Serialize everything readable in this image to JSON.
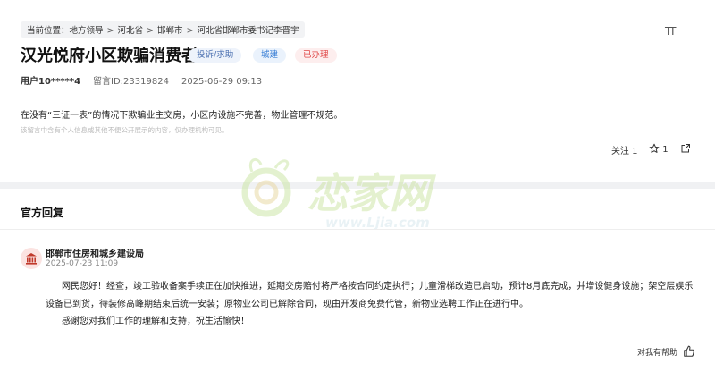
{
  "breadcrumb": {
    "prefix": "当前位置：",
    "items": [
      "地方领导",
      "河北省",
      "邯郸市",
      "河北省邯郸市委书记李晋宇"
    ]
  },
  "font_toggle": "TT",
  "message": {
    "title": "汉光悦府小区欺骗消费者",
    "tags": {
      "type": "投诉/求助",
      "category": "城建",
      "status": "已办理"
    },
    "user": "用户10*****4",
    "message_id": "留言ID:23319824",
    "date": "2025-06-29 09:13",
    "content": "在没有“三证一表”的情况下欺骗业主交房，小区内设施不完善，物业管理不规范。",
    "note": "该留言中含有个人信息或其他不便公开展示的内容，仅办理机构可见。",
    "follow": "关注 1",
    "stars": "1"
  },
  "watermark": {
    "logo": "恋家网",
    "url": "www.Ljia.com"
  },
  "reply_section": {
    "title": "官方回复",
    "org": "邯郸市住房和城乡建设局",
    "time": "2025-07-23 11:09",
    "p1": "网民您好！经查，竣工验收备案手续正在加快推进，延期交房赔付将严格按合同约定执行；儿童滑梯改造已启动，预计8月底完成，并增设健身设施；架空层娱乐设备已到货，待装修高峰期结束后统一安装；原物业公司已解除合同，现由开发商免费代管，新物业选聘工作正在进行中。",
    "p2": "感谢您对我们工作的理解和支持，祝生活愉快！",
    "helpful": "对我有帮助"
  },
  "colors": {
    "status_red": "#e04848",
    "category_blue": "#3a7fd5",
    "type_blue": "#4a6fb0",
    "brand_red": "#c0392b"
  }
}
